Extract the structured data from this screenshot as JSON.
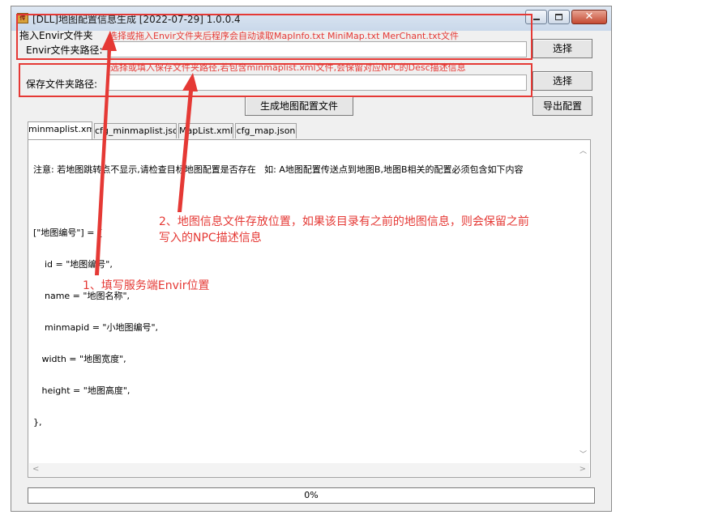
{
  "window": {
    "title": "[DLL]地图配置信息生成 [2022-07-29] 1.0.0.4",
    "app_icon": "app-logo-icon",
    "controls": {
      "minimize": "minimize-icon",
      "maximize": "maximize-icon",
      "close_glyph": "✕"
    }
  },
  "envir": {
    "drag_label": "拖入Envir文件夹",
    "hint": "选择或拖入Envir文件夹后程序会自动读取MapInfo.txt  MiniMap.txt  MerChant.txt文件",
    "path_label": "Envir文件夹路径:",
    "path_value": "",
    "select_button": "选择"
  },
  "save": {
    "hint": "选择或填入保存文件夹路径,若包含minmaplist.xml文件,会保留对应NPC的Desc描述信息",
    "path_label": "保存文件夹路径:",
    "path_value": "",
    "select_button": "选择"
  },
  "actions": {
    "generate_button": "生成地图配置文件",
    "export_button": "导出配置"
  },
  "tabs": [
    {
      "label": "minmaplist.xml",
      "active": true
    },
    {
      "label": "cfg_minmaplist.json",
      "active": false
    },
    {
      "label": "MapList.xml",
      "active": false
    },
    {
      "label": "cfg_map.json",
      "active": false
    }
  ],
  "memo": {
    "lines": [
      "注意: 若地图跳转点不显示,请检查目标地图配置是否存在   如: A地图配置传送点到地图B,地图B相关的配置必须包含如下内容",
      "",
      "[\"地图编号\"] = {",
      "    id = \"地图编号\",",
      "    name = \"地图名称\",",
      "    minmapid = \"小地图编号\",",
      "   width = \"地图宽度\",",
      "   height = \"地图高度\",",
      "},"
    ]
  },
  "progress": {
    "value": 0,
    "label": "0%"
  },
  "annotations": {
    "note1": "1、填写服务端Envir位置",
    "note2_line1": "2、地图信息文件存放位置，如果该目录有之前的地图信息，则会保留之前",
    "note2_line2": "写入的NPC描述信息",
    "color": "#e53935"
  }
}
